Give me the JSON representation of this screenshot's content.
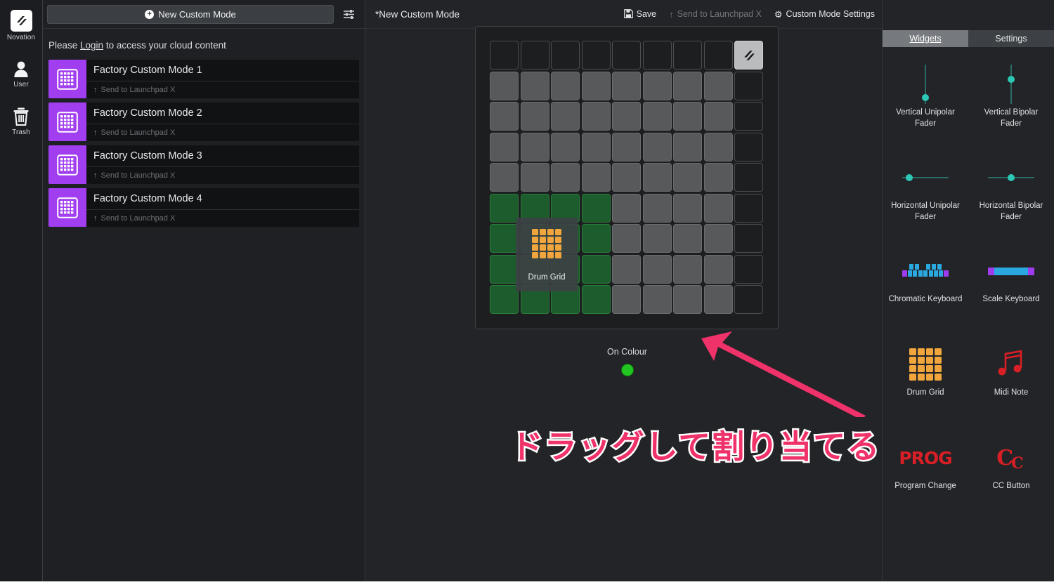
{
  "rail": {
    "items": [
      {
        "label": "Novation",
        "icon": "novation-logo-icon"
      },
      {
        "label": "User",
        "icon": "user-icon"
      },
      {
        "label": "Trash",
        "icon": "trash-icon"
      }
    ]
  },
  "modes_panel": {
    "new_mode_button": "New Custom Mode",
    "new_mode_plus": "+",
    "filter_icon": "sliders-icon",
    "cloud_message_prefix": "Please ",
    "cloud_message_link": "Login",
    "cloud_message_suffix": " to access your cloud content",
    "send_label": "Send to Launchpad X",
    "send_arrow": "↑",
    "modes": [
      {
        "name": "Factory Custom Mode 1"
      },
      {
        "name": "Factory Custom Mode 2"
      },
      {
        "name": "Factory Custom Mode 3"
      },
      {
        "name": "Factory Custom Mode 4"
      }
    ]
  },
  "editor": {
    "title": "*New Custom Mode",
    "save_label": "Save",
    "save_icon": "💾",
    "send_label": "Send to Launchpad X",
    "send_icon": "↑",
    "settings_label": "Custom Mode Settings",
    "settings_icon": "⚙",
    "on_colour_label": "On Colour",
    "on_colour_value": "#22c522",
    "drag_ghost_label": "Drum Grid",
    "annotation_text": "ドラッグして割り当てる",
    "annotation_color": "#f0326a",
    "pad_grid": {
      "rows": 9,
      "cols": 9,
      "cells": [
        [
          "off",
          "off",
          "off",
          "off",
          "off",
          "off",
          "off",
          "off",
          "logo"
        ],
        [
          "gray",
          "gray",
          "gray",
          "gray",
          "gray",
          "gray",
          "gray",
          "gray",
          "off"
        ],
        [
          "gray",
          "gray",
          "gray",
          "gray",
          "gray",
          "gray",
          "gray",
          "gray",
          "off"
        ],
        [
          "gray",
          "gray",
          "gray",
          "gray",
          "gray",
          "gray",
          "gray",
          "gray",
          "off"
        ],
        [
          "gray",
          "gray",
          "gray",
          "gray",
          "gray",
          "gray",
          "gray",
          "gray",
          "off"
        ],
        [
          "green",
          "green",
          "green",
          "green",
          "gray",
          "gray",
          "gray",
          "gray",
          "off"
        ],
        [
          "green",
          "green",
          "green",
          "green",
          "gray",
          "gray",
          "gray",
          "gray",
          "off"
        ],
        [
          "green",
          "green",
          "green",
          "green",
          "gray",
          "gray",
          "gray",
          "gray",
          "off"
        ],
        [
          "green",
          "green",
          "green",
          "green",
          "gray",
          "gray",
          "gray",
          "gray",
          "off"
        ]
      ]
    }
  },
  "right_panel": {
    "tabs": [
      {
        "label": "Widgets",
        "active": true
      },
      {
        "label": "Settings",
        "active": false
      }
    ],
    "widgets": [
      {
        "label": "Vertical Unipolar Fader",
        "icon": "vertical-unipolar-fader-icon"
      },
      {
        "label": "Vertical Bipolar Fader",
        "icon": "vertical-bipolar-fader-icon"
      },
      {
        "label": "Horizontal Unipolar Fader",
        "icon": "horizontal-unipolar-fader-icon"
      },
      {
        "label": "Horizontal Bipolar Fader",
        "icon": "horizontal-bipolar-fader-icon"
      },
      {
        "label": "Chromatic Keyboard",
        "icon": "chromatic-keyboard-icon"
      },
      {
        "label": "Scale Keyboard",
        "icon": "scale-keyboard-icon"
      },
      {
        "label": "Drum Grid",
        "icon": "drum-grid-icon"
      },
      {
        "label": "Midi Note",
        "icon": "midi-note-icon"
      },
      {
        "label": "Program Change",
        "icon": "program-change-icon",
        "glyph": "PROG"
      },
      {
        "label": "CC Button",
        "icon": "cc-button-icon",
        "glyph": "CC"
      }
    ]
  }
}
